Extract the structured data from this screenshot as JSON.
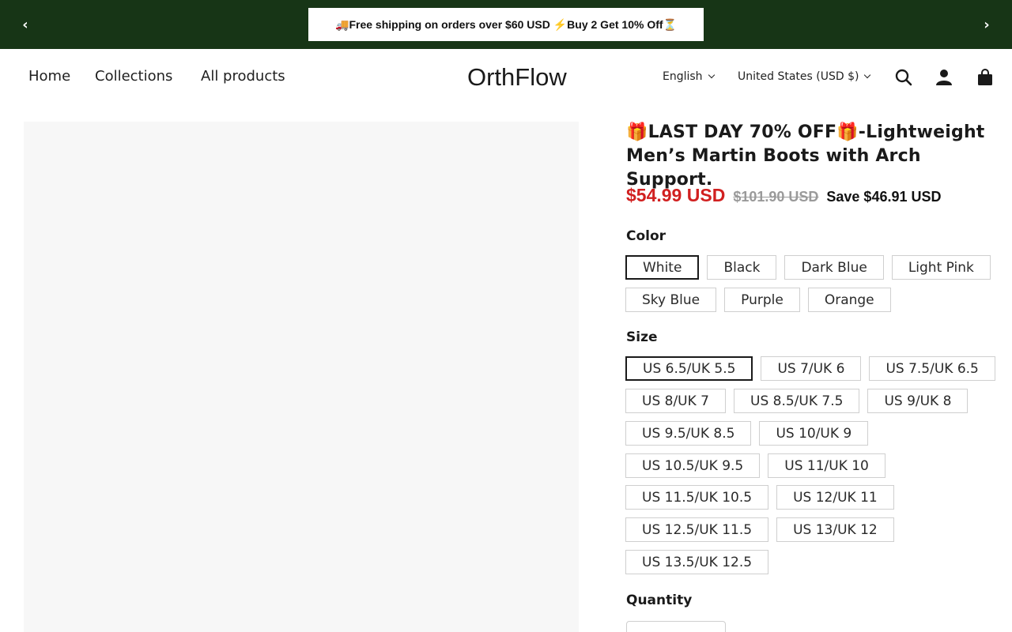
{
  "announcement": {
    "text": "🚚Free shipping on orders over $60 USD ⚡Buy 2 Get 10% Off⏳",
    "prev_icon": "chevron-left-icon",
    "next_icon": "chevron-right-icon"
  },
  "header": {
    "nav": [
      "Home",
      "Collections",
      "All products"
    ],
    "logo": "OrthFlow",
    "language": "English",
    "country": "United States (USD $)",
    "icons": [
      "search-icon",
      "account-icon",
      "cart-icon"
    ]
  },
  "product": {
    "title": "🎁LAST DAY 70% OFF🎁-Lightweight Men’s Martin Boots with Arch Support.",
    "price_sale": "$54.99 USD",
    "price_compare": "$101.90 USD",
    "price_save": "Save $46.91 USD",
    "color_label": "Color",
    "colors_row1": [
      "White",
      "Black",
      "Dark Blue",
      "Light Pink"
    ],
    "colors_row2": [
      "Sky Blue",
      "Purple",
      "Orange"
    ],
    "size_label": "Size",
    "sizes_rows": [
      [
        "US 6.5/UK 5.5",
        "US 7/UK 6",
        "US 7.5/UK 6.5"
      ],
      [
        "US 8/UK 7",
        "US 8.5/UK 7.5",
        "US 9/UK 8"
      ],
      [
        "US 9.5/UK 8.5",
        "US 10/UK 9"
      ],
      [
        "US 10.5/UK 9.5",
        "US 11/UK 10"
      ],
      [
        "US 11.5/UK 10.5",
        "US 12/UK 11"
      ],
      [
        "US 12.5/UK 11.5",
        "US 13/UK 12"
      ],
      [
        "US 13.5/UK 12.5"
      ]
    ],
    "quantity_label": "Quantity"
  },
  "colors": {
    "announcement_bg": "#173516",
    "sale_price": "#d12020"
  }
}
